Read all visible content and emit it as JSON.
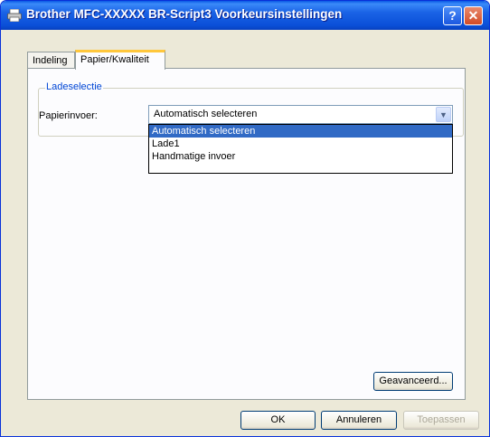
{
  "window": {
    "title": "Brother MFC-XXXXX BR-Script3 Voorkeursinstellingen"
  },
  "tabs": [
    {
      "label": "Indeling"
    },
    {
      "label": "Papier/Kwaliteit"
    }
  ],
  "tray_group": {
    "label": "Ladeselectie",
    "paper_source": {
      "label": "Papierinvoer:",
      "value": "Automatisch selecteren",
      "options": [
        "Automatisch selecteren",
        "Lade1",
        "Handmatige invoer"
      ]
    }
  },
  "buttons": {
    "advanced": "Geavanceerd...",
    "ok": "OK",
    "cancel": "Annuleren",
    "apply": "Toepassen"
  },
  "colors": {
    "titlebar": "#0a4fd8",
    "selection": "#316ac5",
    "group_label": "#0046d5"
  }
}
